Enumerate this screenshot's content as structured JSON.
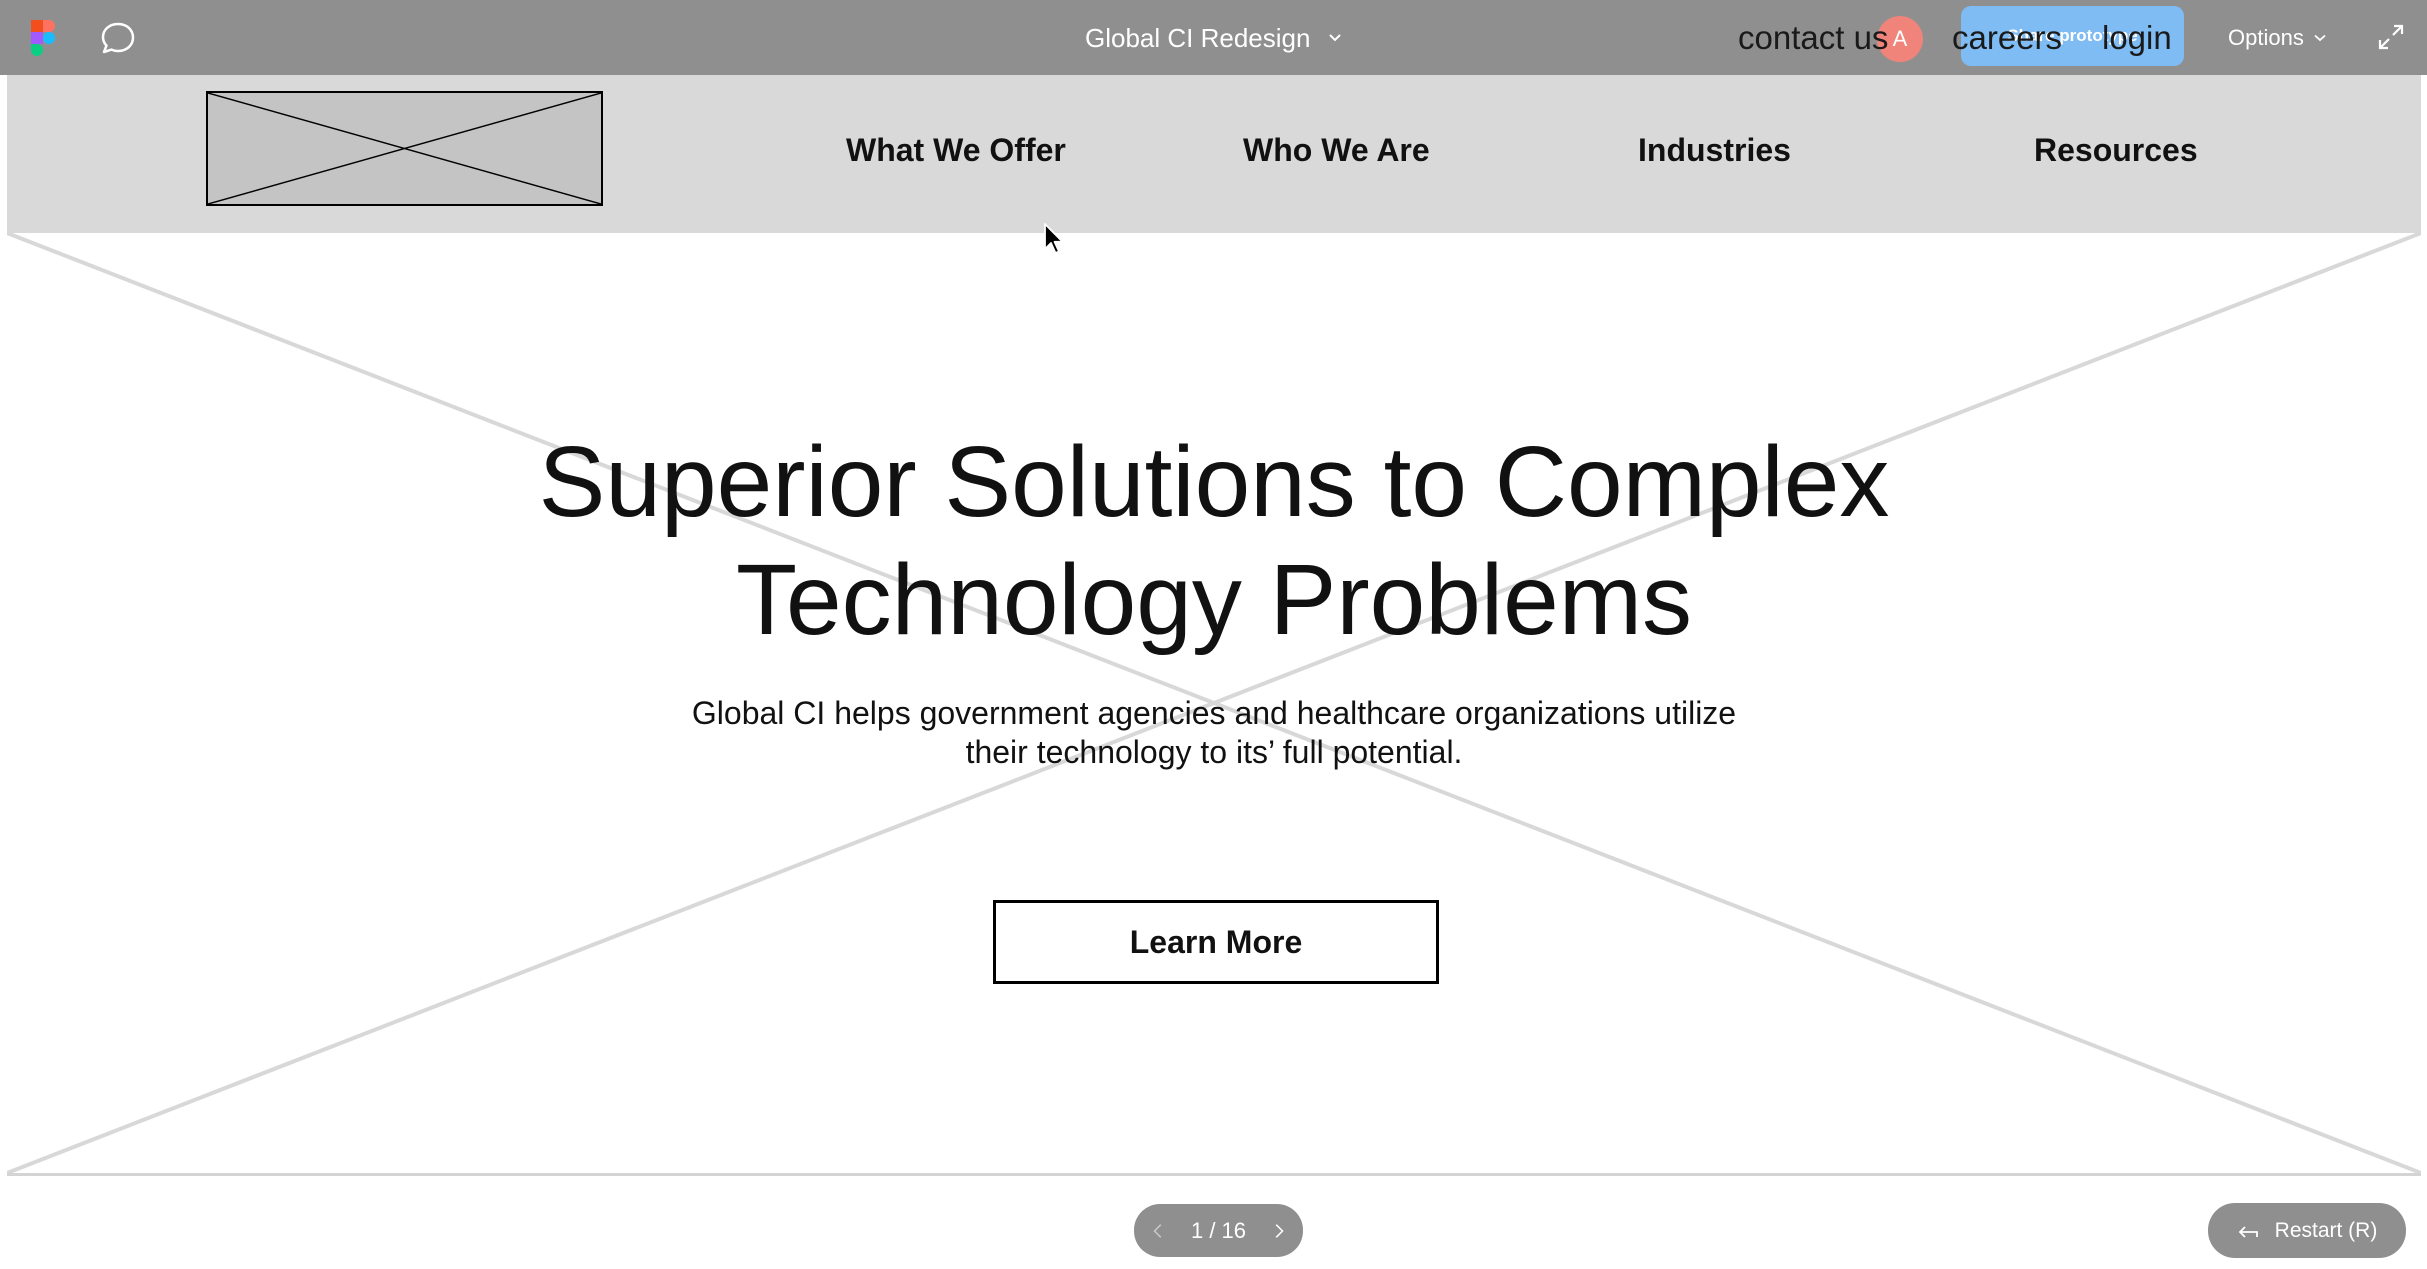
{
  "figma_bar": {
    "logo_icon": "figma-logo-icon",
    "comment_icon": "comment-bubble-icon",
    "file_title": "Global CI Redesign",
    "title_menu_icon": "chevron-down-icon",
    "avatar_initial": "A",
    "share_label": "Share prototype",
    "overlay_links": [
      "contact us",
      "careers",
      "login"
    ],
    "options_label": "Options",
    "fullscreen_icon": "expand-icon"
  },
  "site": {
    "logo_placeholder": "image-placeholder",
    "nav": [
      "What We Offer",
      "Who We Are",
      "Industries",
      "Resources"
    ],
    "hero": {
      "title_line1": "Superior Solutions to Complex",
      "title_line2": "Technology Problems",
      "subtitle_line1": "Global CI helps government agencies and healthcare organizations utilize",
      "subtitle_line2": "their technology to its’ full potential.",
      "cta_label": "Learn More"
    }
  },
  "controls": {
    "page_indicator": "1 / 16",
    "prev_icon": "chevron-left-icon",
    "next_icon": "chevron-right-icon",
    "restart_label": "Restart (R)",
    "restart_icon": "undo-arrow-icon"
  },
  "colors": {
    "toolbar": "#8f8f8f",
    "share_button": "#7fbcf4",
    "avatar": "#f0847a",
    "header_bg": "#d9d9d9",
    "placeholder_fill": "#c4c4c4"
  }
}
